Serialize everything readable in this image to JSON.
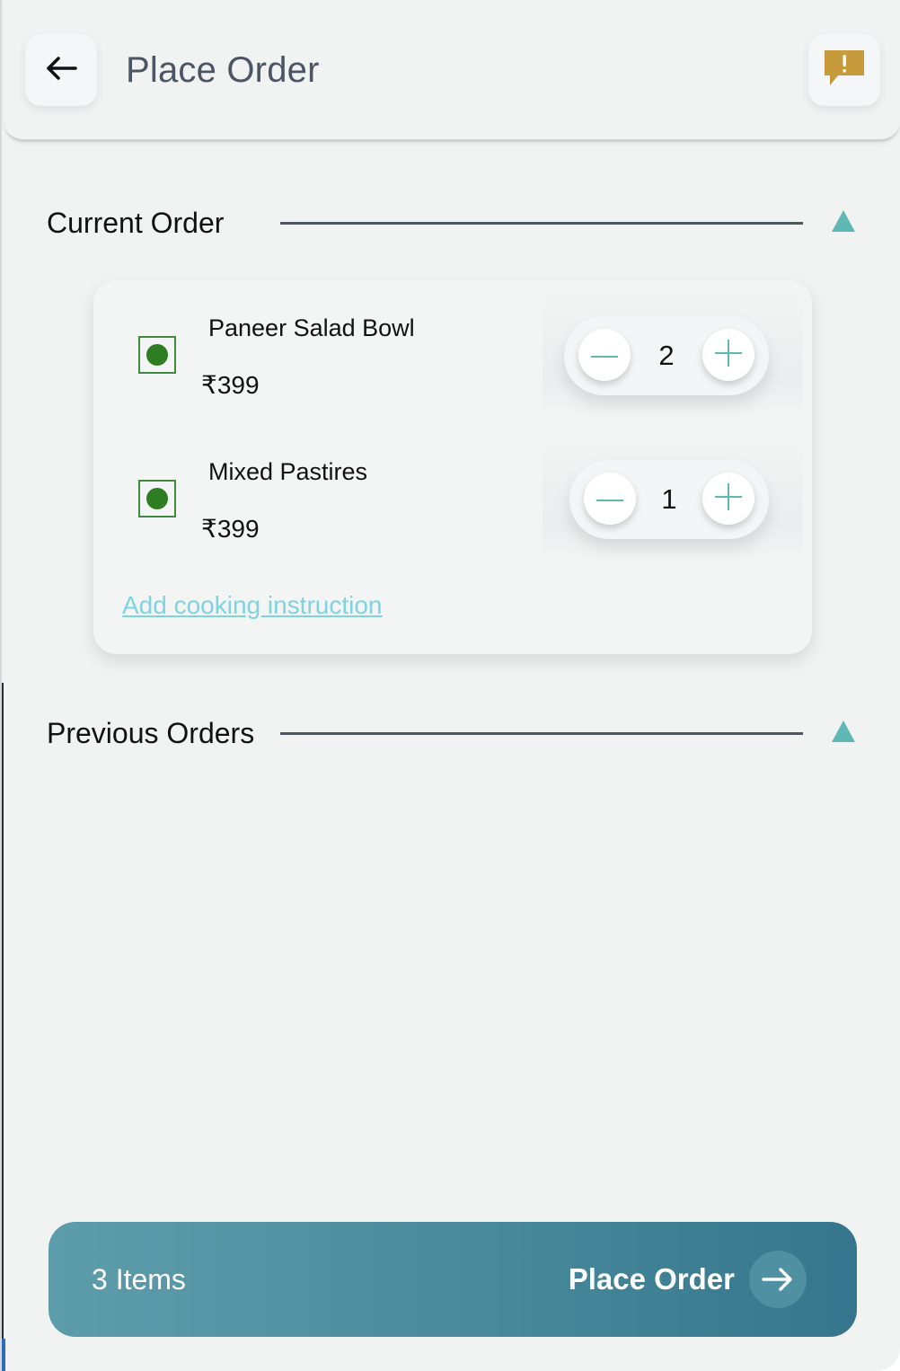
{
  "header": {
    "title": "Place Order",
    "back_icon": "arrow-left-icon",
    "report_icon": "report-message-icon",
    "report_color": "#c79a3b"
  },
  "current_order": {
    "title": "Current Order",
    "toggle_icon": "triangle-up-icon",
    "items": [
      {
        "name": "Paneer Salad Bowl",
        "price": "₹399",
        "quantity": "2",
        "veg": true
      },
      {
        "name": "Mixed Pastires",
        "price": "₹399",
        "quantity": "1",
        "veg": true
      }
    ],
    "cooking_instruction_link": "Add cooking instruction"
  },
  "previous_orders": {
    "title": "Previous Orders",
    "toggle_icon": "triangle-up-icon"
  },
  "checkout": {
    "items_count": "3 Items",
    "button_label": "Place Order",
    "arrow_icon": "arrow-right-icon"
  },
  "colors": {
    "accent": "#5fb8b3",
    "veg_green": "#2e7d22",
    "link": "#7fd3df",
    "checkout_start": "#5d9dab",
    "checkout_end": "#35768d"
  }
}
